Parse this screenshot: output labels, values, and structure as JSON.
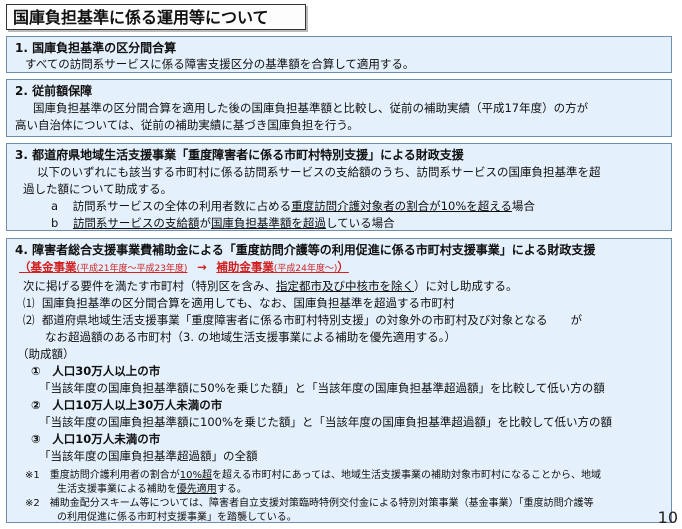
{
  "title": "国庫負担基準に係る運用等について",
  "s1": {
    "heading": "1. 国庫負担基準の区分間合算",
    "body": "すべての訪問系サービスに係る障害支援区分の基準額を合算して適用する。"
  },
  "s2": {
    "heading": "2. 従前額保障",
    "line1": "国庫負担基準の区分間合算を適用した後の国庫負担基準額と比較し、従前の補助実績（平成17年度）の方が",
    "line2": "高い自治体については、従前の補助実績に基づき国庫負担を行う。"
  },
  "s3": {
    "heading": "3. 都道府県地域生活支援事業「重度障害者に係る市町村特別支援」による財政支援",
    "line1": "以下のいずれにも該当する市町村に係る訪問系サービスの支給額のうち、訪問系サービスの国庫負担基準を超",
    "line2": "過した額について助成する。",
    "a_mark": "a",
    "a_pre": "訪問系サービスの全体の利用者数に占める",
    "a_ul": "重度訪問介護対象者の割合が10%を超える",
    "a_post": "場合",
    "b_mark": "b",
    "b_ul1": "訪問系サービスの支給額",
    "b_mid": "が",
    "b_ul2": "国庫負担基準額を超過",
    "b_post": "している場合"
  },
  "s4": {
    "heading": "4. 障害者総合支援事業費補助金による「重度訪問介護等の利用促進に係る市町村支援事業」による財政支援",
    "red_a": "（基金事業",
    "red_a_small": "(平成21年度～平成23年度)",
    "red_arrow": "→",
    "red_b": "補助金事業",
    "red_b_small": "(平成24年度～)",
    "red_c": "）",
    "intro_pre": "次に掲げる要件を満たす市町村（特別区を含み、",
    "intro_ul": "指定都市及び中核市を除く",
    "intro_post": "）に対し助成する。",
    "c1_mark": "⑴",
    "c1": "国庫負担基準の区分間合算を適用しても、なお、国庫負担基準を超過する市町村",
    "c2_mark": "⑵",
    "c2a": "都道府県地域生活支援事業「重度障害者に係る市町村特別支援」の対象外の市町村及び対象となる　　が",
    "c2b": "なお超過額のある市町村（3. の地域生活支援事業による補助を優先適用する。）",
    "grant_heading": "（助成額）",
    "g1_head": "①　人口30万人以上の市",
    "g1_body": "「当該年度の国庫負担基準額に50%を乗じた額」と「当該年度の国庫負担基準超過額」を比較して低い方の額",
    "g2_head": "②　人口10万人以上30万人未満の市",
    "g2_body": "「当該年度の国庫負担基準額に100%を乗じた額」と「当該年度の国庫負担基準超過額」を比較して低い方の額",
    "g3_head": "③　人口10万人未満の市",
    "g3_body": "「当該年度の国庫負担基準超過額」の全額",
    "n1_pre": "※1　重度訪問介護利用者の割合が",
    "n1_ul": "10%超",
    "n1_post": "を超える市町村にあっては、地域生活支援事業の補助対象市町村になることから、地域",
    "n1b_pre": "生活支援事業による補助を",
    "n1b_ul": "優先適用",
    "n1b_post": "する。",
    "n2a": "※2　補助金配分スキーム等については、障害者自立支援対策臨時特例交付金による特別対策事業（基金事業）「重度訪問介護等",
    "n2b": "の利用促進に係る市町村支援事業」を踏襲している。"
  },
  "page_number": "10"
}
